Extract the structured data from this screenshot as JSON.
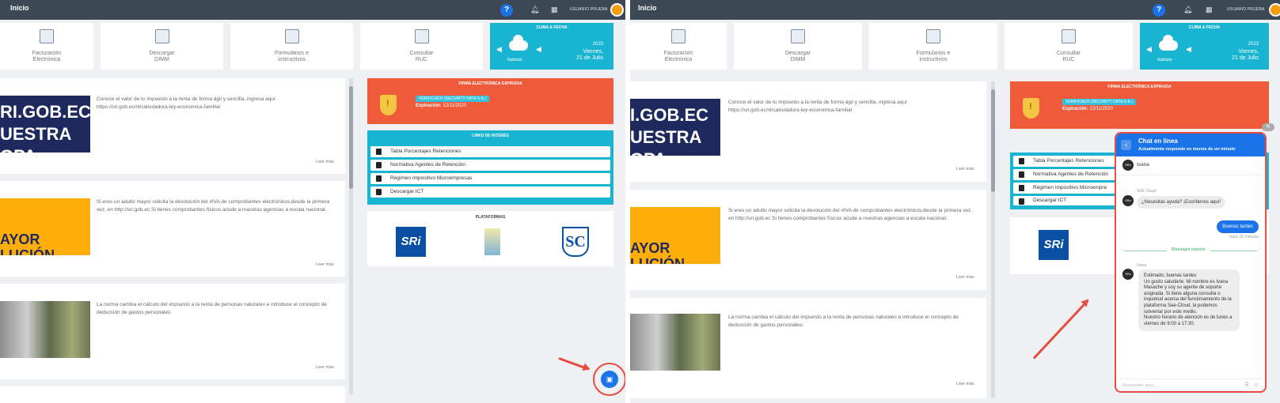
{
  "topbar": {
    "title": "Inicio",
    "help": "?",
    "user": "USUARIO PRUEBA"
  },
  "tiles": [
    {
      "label": "Facturación\nElectrónica",
      "icon": "invoice-icon"
    },
    {
      "label": "Descargar\nDIMM",
      "icon": "download-icon"
    },
    {
      "label": "Formularios e\ninstructivos",
      "icon": "document-icon"
    },
    {
      "label": "Consultar\nRUC",
      "icon": "search-icon"
    }
  ],
  "weather": {
    "title": "CLIMA & FECHA",
    "condition": "Nublado",
    "year": "2023",
    "date": "Viernes,\n21 de Julio"
  },
  "feed": [
    {
      "text": "Conoce el valor de tu impuesto a la renta de forma ágil y sencilla, ingresa aquí https://sri.gob.ec/nl/calculadora-ley-economica-familiar",
      "thumb": "RI.GOB.EC\nUESTRA\nOPA",
      "more": "Leer más"
    },
    {
      "text": "Si eres un adulto mayor solicita la devolución del #IVA de comprobantes electrónicos,desde la primera vez, en http://sri.gob.ec Si tienes comprobantes físicos acude a nuestras agencias a escala nacional.",
      "thumb": "AYOR\nLUCIÓN",
      "more": "Leer más"
    },
    {
      "text": "La norma cambia el cálculo del impuesto a la renta de personas naturales e introduce el concepto de deducción de gastos personales.",
      "thumb": "",
      "more": "Leer más"
    }
  ],
  "feed_s2": [
    {
      "thumb": "I.GOB.EC\nUESTRA\nOPA"
    },
    {
      "thumb": "AYOR\nLUCIÓN"
    }
  ],
  "firma": {
    "title": "FIRMA ELECTRÓNICA EXPIRADA",
    "badge": "VERIFICADO (SECURITY DATA S.A.)",
    "exp_label": "Expiración:",
    "exp_value": "12/11/2020"
  },
  "links": {
    "title": "LINKS DE INTERÉS",
    "items": [
      "Tabla Porcentajes Retenciones",
      "Normativa Agentes de Retención",
      "Régimen Impositivo Microempresas",
      "Descargar ICT"
    ]
  },
  "links_s2": [
    "Tabla Porcentajes Retenciones",
    "Normativa Agentes de Retención",
    "Régimen Impositivo Microempre",
    "Descargar ICT"
  ],
  "plataformas": {
    "title": "PLATAFORMAS",
    "sri": "SRi",
    "sc": "SC"
  },
  "chat": {
    "title": "Chat en línea",
    "subtitle": "Actualmente responde en menos de un minuto",
    "agent_initials": "SRu",
    "agent_name": "Ivana",
    "bot_sender": "SAE Cloud",
    "bot_msg": "¿Necesitas ayuda? ¡Escríbenos aquí!",
    "user_msg": "Buenas tardes",
    "user_time": "hace 10 minutos",
    "new_label": "Mensajes nuevos",
    "reply_sender": "Ivana",
    "reply_msg": "Estimado, buenas tardes\nUn gusto saludarle. Mi nombre es Ivana Masache y soy su agente de soporte asignada. Si tiene alguna consulta o inquietud acerca del funcionamiento de la plataforma Sae-Cloud, la podemos solventar por este medio.\nNuestro horario de atención es de lunes a viernes de 9:00 a 17:30.",
    "input_placeholder": "Responder aquí..."
  },
  "colors": {
    "topbar": "#3c4955",
    "accent": "#1a73e8",
    "cyan": "#19b4d1",
    "red": "#ee5a3a",
    "highlight": "#e74c3c"
  }
}
